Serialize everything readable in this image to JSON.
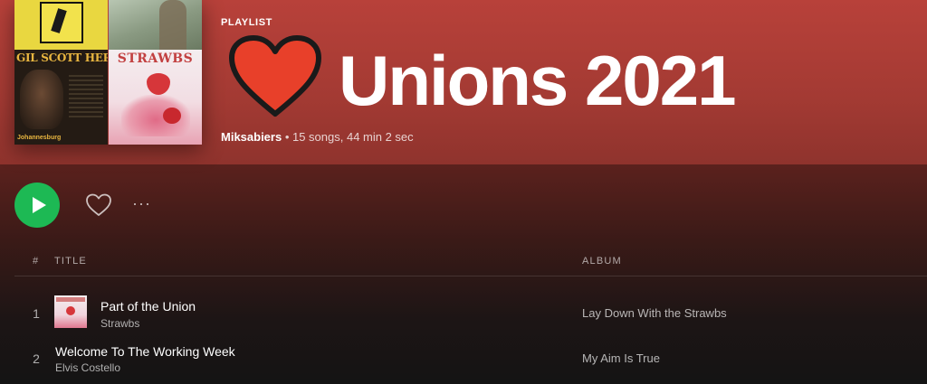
{
  "playlist": {
    "type_label": "PLAYLIST",
    "title": "Unions 2021",
    "owner": "Miksabiers",
    "stats": " • 15 songs, 44 min 2 sec",
    "cover_texts": {
      "scott_heron": "GIL SCOTT HERON",
      "johannesburg": "Johannesburg",
      "strawbs": "STRAWBS"
    }
  },
  "controls": {
    "play_icon": "play-icon",
    "like_icon": "heart-outline-icon",
    "more_label": "···"
  },
  "columns": {
    "number": "#",
    "title": "TITLE",
    "album": "ALBUM"
  },
  "tracks": [
    {
      "number": "1",
      "title": "Part of the Union",
      "artist": "Strawbs",
      "album": "Lay Down With the Strawbs"
    },
    {
      "number": "2",
      "title": "Welcome To The Working Week",
      "artist": "Elvis Costello",
      "album": "My Aim Is True"
    }
  ],
  "colors": {
    "accent": "#1db954",
    "header": "#b8413a",
    "heart_red": "#e8402a"
  }
}
